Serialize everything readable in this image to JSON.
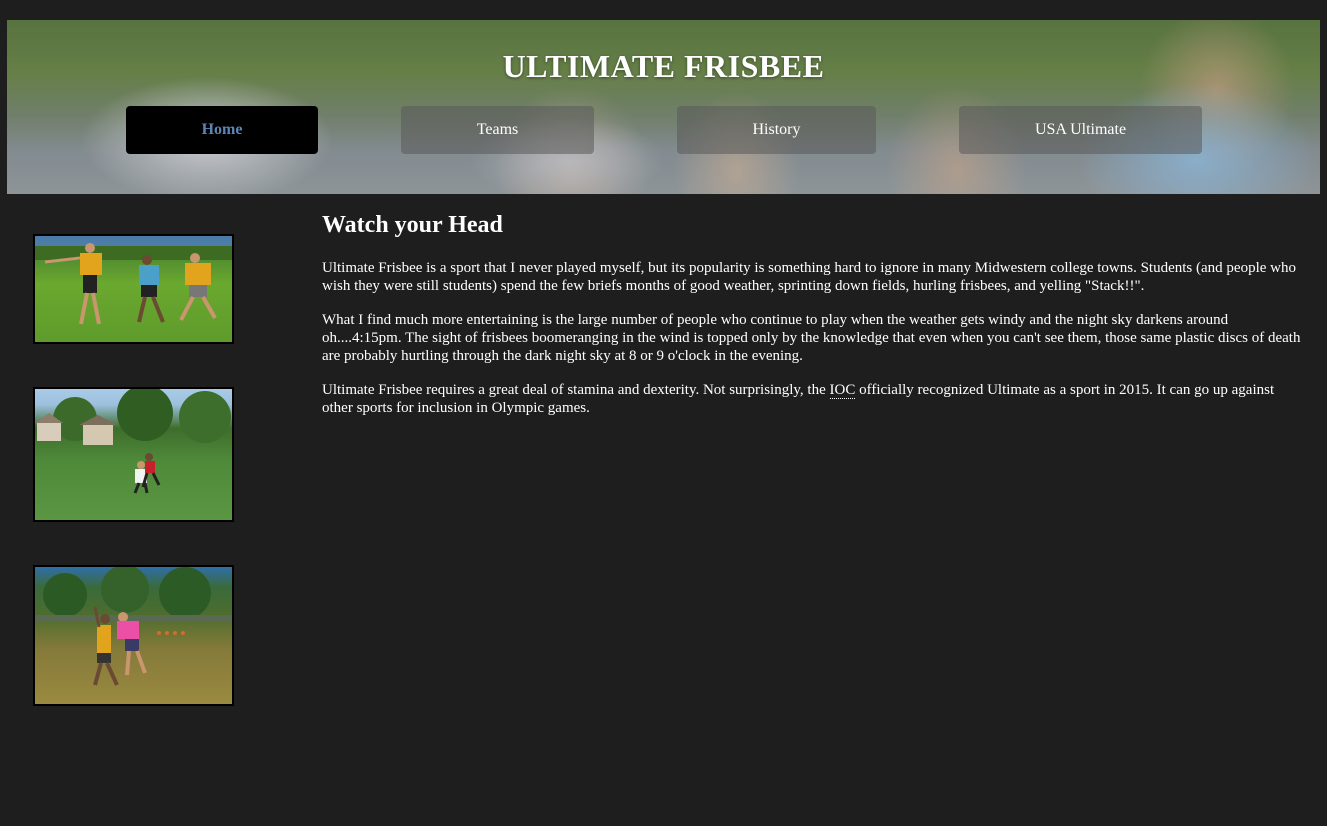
{
  "header": {
    "title": "ULTIMATE FRISBEE",
    "nav": [
      {
        "label": "Home",
        "active": true
      },
      {
        "label": "Teams",
        "active": false
      },
      {
        "label": "History",
        "active": false
      },
      {
        "label": "USA Ultimate",
        "active": false
      }
    ]
  },
  "colors": {
    "page_background": "#1e1e1e",
    "active_nav_background": "#000000",
    "active_nav_text": "#5b86b4",
    "text": "#ffffff"
  },
  "sidebar": {
    "images": [
      {
        "name": "ultimate-players-photo-1"
      },
      {
        "name": "ultimate-players-photo-2"
      },
      {
        "name": "ultimate-players-photo-3"
      }
    ]
  },
  "main": {
    "heading": "Watch your Head",
    "paragraph1": "Ultimate Frisbee is a sport that I never played myself, but its popularity is something hard to ignore in many Midwestern college towns. Students (and people who wish they were still students) spend the few briefs months of good weather, sprinting down fields, hurling frisbees, and yelling \"Stack!!\".",
    "paragraph2": "What I find much more entertaining is the large number of people who continue to play when the weather gets windy and the night sky darkens around oh....4:15pm. The sight of frisbees boomeranging in the wind is topped only by the knowledge that even when you can't see them, those same plastic discs of death are probably hurtling through the dark night sky at 8 or 9 o'clock in the evening.",
    "paragraph3_before": "Ultimate Frisbee requires a great deal of stamina and dexterity. Not surprisingly, the ",
    "paragraph3_abbr": "IOC",
    "paragraph3_after": " officially recognized Ultimate as a sport in 2015. It can go up against other sports for inclusion in Olympic games."
  }
}
